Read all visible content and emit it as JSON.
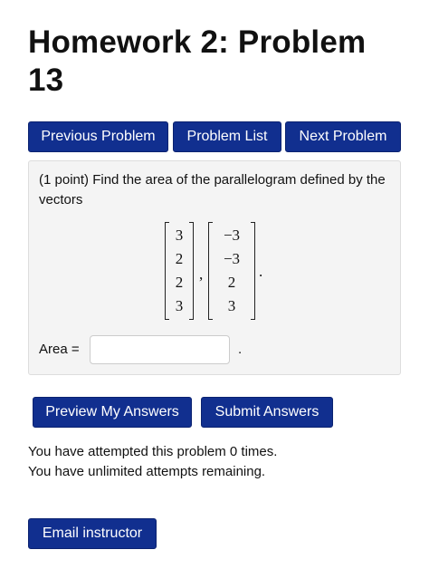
{
  "header": {
    "title": "Homework 2: Problem 13"
  },
  "nav": {
    "previous_label": "Previous Problem",
    "list_label": "Problem List",
    "next_label": "Next Problem"
  },
  "problem": {
    "text": "(1 point) Find the area of the parallelogram defined by the vectors",
    "vector1": [
      "3",
      "2",
      "2",
      "3"
    ],
    "vector2": [
      "−3",
      "−3",
      "2",
      "3"
    ],
    "separator": ",",
    "end_punct": ".",
    "answer_label": "Area =",
    "answer_value": "",
    "answer_suffix": "."
  },
  "actions": {
    "preview_label": "Preview My Answers",
    "submit_label": "Submit Answers"
  },
  "status": {
    "attempts_text": "You have attempted this problem 0 times.",
    "remaining_text": "You have unlimited attempts remaining."
  },
  "footer": {
    "email_label": "Email instructor"
  },
  "colors": {
    "button_bg": "#112f8f",
    "panel_bg": "#f4f4f4"
  }
}
